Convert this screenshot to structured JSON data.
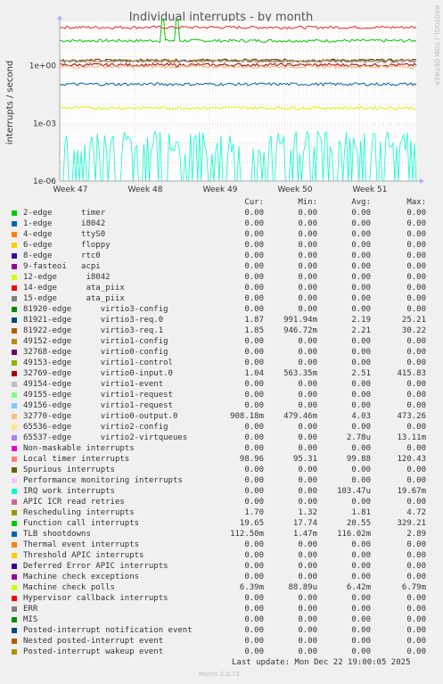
{
  "chart_data": {
    "type": "line",
    "title": "Individual interrupts - by month",
    "ylabel": "interrupts / second",
    "side_label": "RRDTOOL / TOBI OETIKER",
    "yscale": "log",
    "ylim": [
      1e-06,
      200
    ],
    "yticks": [
      {
        "v": 1e-06,
        "label": "1e-06"
      },
      {
        "v": 0.001,
        "label": "1e-03"
      },
      {
        "v": 1,
        "label": "1e+00"
      }
    ],
    "x_ticks": [
      "Week 47",
      "Week 48",
      "Week 49",
      "Week 50",
      "Week 51"
    ],
    "series_approx": [
      {
        "name": "Function call interrupts",
        "color": "#00cc00",
        "level": 20,
        "spike_at": [
          0.29,
          0.33
        ],
        "spike_value": 260
      },
      {
        "name": "Local timer interrupts",
        "color": "#e83030",
        "level": 99
      },
      {
        "name": "virtio3-req.0",
        "color": "#4d2800",
        "level": 1.9
      },
      {
        "name": "virtio3-req.1",
        "color": "#b06000",
        "level": 1.8
      },
      {
        "name": "virtio0-input.0",
        "color": "#a00000",
        "level": 1.1
      },
      {
        "name": "virtio0-output.0",
        "color": "#ffaa66",
        "level": 0.9
      },
      {
        "name": "Rescheduling interrupts",
        "color": "#a0a0a0",
        "level": 1.7
      },
      {
        "name": "TLB shootdowns",
        "color": "#0060a0",
        "level": 0.11
      },
      {
        "name": "Machine check polls",
        "color": "#ccff00",
        "level": 0.0064
      },
      {
        "name": "IRQ work interrupts",
        "color": "#00ffcc",
        "level": "bursts"
      }
    ]
  },
  "legend": {
    "headers": {
      "cur": "Cur:",
      "min": "Min:",
      "avg": "Avg:",
      "max": "Max:"
    },
    "rows": [
      {
        "label": "2-edge      timer",
        "color": "#00cc00",
        "cur": "0.00",
        "min": "0.00",
        "avg": "0.00",
        "max": "0.00"
      },
      {
        "label": "1-edge      i8042",
        "color": "#0066b3",
        "cur": "0.00",
        "min": "0.00",
        "avg": "0.00",
        "max": "0.00"
      },
      {
        "label": "4-edge      ttyS0",
        "color": "#ff8000",
        "cur": "0.00",
        "min": "0.00",
        "avg": "0.00",
        "max": "0.00"
      },
      {
        "label": "6-edge      floppy",
        "color": "#ffcc00",
        "cur": "0.00",
        "min": "0.00",
        "avg": "0.00",
        "max": "0.00"
      },
      {
        "label": "8-edge      rtc0",
        "color": "#330099",
        "cur": "0.00",
        "min": "0.00",
        "avg": "0.00",
        "max": "0.00"
      },
      {
        "label": "9-fasteoi   acpi",
        "color": "#990099",
        "cur": "0.00",
        "min": "0.00",
        "avg": "0.00",
        "max": "0.00"
      },
      {
        "label": "12-edge      i8042",
        "color": "#ccff00",
        "cur": "0.00",
        "min": "0.00",
        "avg": "0.00",
        "max": "0.00"
      },
      {
        "label": "14-edge      ata_piix",
        "color": "#ff0000",
        "cur": "0.00",
        "min": "0.00",
        "avg": "0.00",
        "max": "0.00"
      },
      {
        "label": "15-edge      ata_piix",
        "color": "#808080",
        "cur": "0.00",
        "min": "0.00",
        "avg": "0.00",
        "max": "0.00"
      },
      {
        "label": "81920-edge      virtio3-config",
        "color": "#008f00",
        "cur": "0.00",
        "min": "0.00",
        "avg": "0.00",
        "max": "0.00"
      },
      {
        "label": "81921-edge      virtio3-req.0",
        "color": "#00487d",
        "cur": "1.87",
        "min": "991.94m",
        "avg": "2.19",
        "max": "25.21"
      },
      {
        "label": "81922-edge      virtio3-req.1",
        "color": "#b35a00",
        "cur": "1.85",
        "min": "946.72m",
        "avg": "2.21",
        "max": "30.22"
      },
      {
        "label": "49152-edge      virtio1-config",
        "color": "#b38f00",
        "cur": "0.00",
        "min": "0.00",
        "avg": "0.00",
        "max": "0.00"
      },
      {
        "label": "32768-edge      virtio0-config",
        "color": "#6b006b",
        "cur": "0.00",
        "min": "0.00",
        "avg": "0.00",
        "max": "0.00"
      },
      {
        "label": "49153-edge      virtio1-control",
        "color": "#8fb300",
        "cur": "0.00",
        "min": "0.00",
        "avg": "0.00",
        "max": "0.00"
      },
      {
        "label": "32769-edge      virtio0-input.0",
        "color": "#b30000",
        "cur": "1.04",
        "min": "563.35m",
        "avg": "2.51",
        "max": "415.83"
      },
      {
        "label": "49154-edge      virtio1-event",
        "color": "#bebebe",
        "cur": "0.00",
        "min": "0.00",
        "avg": "0.00",
        "max": "0.00"
      },
      {
        "label": "49155-edge      virtio1-request",
        "color": "#80ff80",
        "cur": "0.00",
        "min": "0.00",
        "avg": "0.00",
        "max": "0.00"
      },
      {
        "label": "49156-edge      virtio1-request",
        "color": "#80c9ff",
        "cur": "0.00",
        "min": "0.00",
        "avg": "0.00",
        "max": "0.00"
      },
      {
        "label": "32770-edge      virtio0-output.0",
        "color": "#ffc080",
        "cur": "908.18m",
        "min": "479.46m",
        "avg": "4.03",
        "max": "473.26"
      },
      {
        "label": "65536-edge      virtio2-config",
        "color": "#ffe680",
        "cur": "0.00",
        "min": "0.00",
        "avg": "0.00",
        "max": "0.00"
      },
      {
        "label": "65537-edge      virtio2-virtqueues",
        "color": "#aa80ff",
        "cur": "0.00",
        "min": "0.00",
        "avg": "2.78u",
        "max": "13.11m"
      },
      {
        "label": "Non-maskable interrupts",
        "color": "#ee00cc",
        "cur": "0.00",
        "min": "0.00",
        "avg": "0.00",
        "max": "0.00"
      },
      {
        "label": "Local timer interrupts",
        "color": "#ff8080",
        "cur": "98.96",
        "min": "95.31",
        "avg": "99.88",
        "max": "120.43"
      },
      {
        "label": "Spurious interrupts",
        "color": "#666600",
        "cur": "0.00",
        "min": "0.00",
        "avg": "0.00",
        "max": "0.00"
      },
      {
        "label": "Performance monitoring interrupts",
        "color": "#ffbfff",
        "cur": "0.00",
        "min": "0.00",
        "avg": "0.00",
        "max": "0.00"
      },
      {
        "label": "IRQ work interrupts",
        "color": "#00ffcc",
        "cur": "0.00",
        "min": "0.00",
        "avg": "103.47u",
        "max": "19.67m"
      },
      {
        "label": "APIC ICR read retries",
        "color": "#cc6699",
        "cur": "0.00",
        "min": "0.00",
        "avg": "0.00",
        "max": "0.00"
      },
      {
        "label": "Rescheduling interrupts",
        "color": "#999900",
        "cur": "1.70",
        "min": "1.32",
        "avg": "1.81",
        "max": "4.72"
      },
      {
        "label": "Function call interrupts",
        "color": "#00cc00",
        "cur": "19.65",
        "min": "17.74",
        "avg": "20.55",
        "max": "329.21"
      },
      {
        "label": "TLB shootdowns",
        "color": "#0066b3",
        "cur": "112.50m",
        "min": "1.47m",
        "avg": "116.02m",
        "max": "2.89"
      },
      {
        "label": "Thermal event interrupts",
        "color": "#ff8000",
        "cur": "0.00",
        "min": "0.00",
        "avg": "0.00",
        "max": "0.00"
      },
      {
        "label": "Threshold APIC interrupts",
        "color": "#ffcc00",
        "cur": "0.00",
        "min": "0.00",
        "avg": "0.00",
        "max": "0.00"
      },
      {
        "label": "Deferred Error APIC interrupts",
        "color": "#330099",
        "cur": "0.00",
        "min": "0.00",
        "avg": "0.00",
        "max": "0.00"
      },
      {
        "label": "Machine check exceptions",
        "color": "#990099",
        "cur": "0.00",
        "min": "0.00",
        "avg": "0.00",
        "max": "0.00"
      },
      {
        "label": "Machine check polls",
        "color": "#ccff00",
        "cur": "6.39m",
        "min": "88.89u",
        "avg": "6.42m",
        "max": "6.79m"
      },
      {
        "label": "Hypervisor callback interrupts",
        "color": "#ff0000",
        "cur": "0.00",
        "min": "0.00",
        "avg": "0.00",
        "max": "0.00"
      },
      {
        "label": "ERR",
        "color": "#808080",
        "cur": "0.00",
        "min": "0.00",
        "avg": "0.00",
        "max": "0.00"
      },
      {
        "label": "MIS",
        "color": "#008f00",
        "cur": "0.00",
        "min": "0.00",
        "avg": "0.00",
        "max": "0.00"
      },
      {
        "label": "Posted-interrupt notification event",
        "color": "#00487d",
        "cur": "0.00",
        "min": "0.00",
        "avg": "0.00",
        "max": "0.00"
      },
      {
        "label": "Nested posted-interrupt event",
        "color": "#b35a00",
        "cur": "0.00",
        "min": "0.00",
        "avg": "0.00",
        "max": "0.00"
      },
      {
        "label": "Posted-interrupt wakeup event",
        "color": "#b38f00",
        "cur": "0.00",
        "min": "0.00",
        "avg": "0.00",
        "max": "0.00"
      }
    ]
  },
  "footer": {
    "last_update": "Last update: Mon Dec 22 19:00:05 2025",
    "munin": "Munin 2.0.73"
  }
}
